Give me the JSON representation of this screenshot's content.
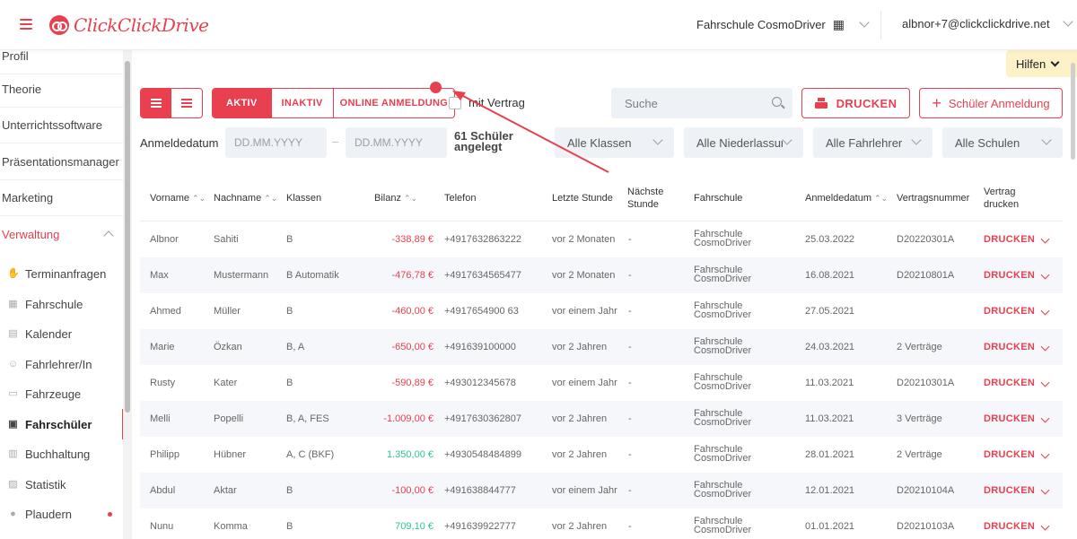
{
  "header": {
    "logo_text": "ClickClickDrive",
    "school": "Fahrschule CosmoDriver",
    "user": "albnor+7@clickclickdrive.net"
  },
  "sidebar": {
    "items": [
      {
        "label": "Profil"
      },
      {
        "label": "Theorie"
      },
      {
        "label": "Unterrichtssoftware"
      },
      {
        "label": "Präsentationsmanager"
      },
      {
        "label": "Marketing"
      },
      {
        "label": "Verwaltung"
      }
    ],
    "sub_items": [
      {
        "label": "Terminanfragen",
        "icon": "hand-icon"
      },
      {
        "label": "Fahrschule",
        "icon": "building-icon"
      },
      {
        "label": "Kalender",
        "icon": "calendar-icon"
      },
      {
        "label": "Fahrlehrer/In",
        "icon": "instructor-icon"
      },
      {
        "label": "Fahrzeuge",
        "icon": "car-icon"
      },
      {
        "label": "Fahrschüler",
        "icon": "student-card-icon"
      },
      {
        "label": "Buchhaltung",
        "icon": "ledger-icon"
      },
      {
        "label": "Statistik",
        "icon": "chart-icon"
      },
      {
        "label": "Plaudern",
        "icon": "chat-icon"
      }
    ]
  },
  "toolbar": {
    "hilfen": "Hilfen",
    "tab_active": "AKTIV",
    "tab_inactive": "INAKTIV",
    "tab_online": "ONLINE ANMELDUNG",
    "with_contract": "mit Vertrag",
    "search_placeholder": "Suche",
    "print": "DRUCKEN",
    "add_student": "Schüler Anmeldung"
  },
  "filters": {
    "date_label": "Anmeldedatum",
    "date_from_placeholder": "DD.MM.YYYY",
    "date_to_placeholder": "DD.MM.YYYY",
    "count": "61 Schüler angelegt",
    "classes": "Alle Klassen",
    "branches": "Alle Niederlassungen",
    "instructors": "Alle Fahrlehrer",
    "schools": "Alle Schulen"
  },
  "table": {
    "headers": {
      "first": "Vorname",
      "last": "Nachname",
      "classes": "Klassen",
      "balance": "Bilanz",
      "phone": "Telefon",
      "last_lesson": "Letzte Stunde",
      "next_lesson": "Nächste Stunde",
      "school": "Fahrschule",
      "reg_date": "Anmeldedatum",
      "contract_no": "Vertragsnummer",
      "contract_print": "Vertrag drucken"
    },
    "print_label": "DRUCKEN",
    "rows": [
      {
        "first": "Albnor",
        "last": "Sahiti",
        "classes": "B",
        "balance": "-338,89 €",
        "phone": "+4917632863222",
        "last_lesson": "vor 2 Monaten",
        "next": "-",
        "school": "Fahrschule CosmoDriver",
        "date": "25.03.2022",
        "contract": "D20220301A"
      },
      {
        "first": "Max",
        "last": "Mustermann",
        "classes": "B Automatik",
        "balance": "-476,78 €",
        "phone": "+4917634565477",
        "last_lesson": "vor 2 Monaten",
        "next": "-",
        "school": "Fahrschule CosmoDriver",
        "date": "16.08.2021",
        "contract": "D20210801A"
      },
      {
        "first": "Ahmed",
        "last": "Müller",
        "classes": "B",
        "balance": "-460,00 €",
        "phone": "+4917654900 63",
        "last_lesson": "vor einem Jahr",
        "next": "-",
        "school": "Fahrschule CosmoDriver",
        "date": "27.05.2021",
        "contract": ""
      },
      {
        "first": "Marie",
        "last": "Özkan",
        "classes": "B, A",
        "balance": "-650,00 €",
        "phone": "+491639100000",
        "last_lesson": "vor 2 Jahren",
        "next": "-",
        "school": "Fahrschule CosmoDriver",
        "date": "24.03.2021",
        "contract": "2 Verträge"
      },
      {
        "first": "Rusty",
        "last": "Kater",
        "classes": "B",
        "balance": "-590,89 €",
        "phone": "+493012345678",
        "last_lesson": "vor einem Jahr",
        "next": "-",
        "school": "Fahrschule CosmoDriver",
        "date": "11.03.2021",
        "contract": "D20210301A"
      },
      {
        "first": "Melli",
        "last": "Popelli",
        "classes": "B, A, FES",
        "balance": "-1.009,00 €",
        "phone": "+4917630362807",
        "last_lesson": "vor 2 Jahren",
        "next": "-",
        "school": "Fahrschule CosmoDriver",
        "date": "11.03.2021",
        "contract": "3 Verträge"
      },
      {
        "first": "Philipp",
        "last": "Hübner",
        "classes": "A, C (BKF)",
        "balance": "1.350,00 €",
        "phone": "+4930548484899",
        "last_lesson": "vor 2 Jahren",
        "next": "-",
        "school": "Fahrschule CosmoDriver",
        "date": "28.01.2021",
        "contract": "2 Verträge"
      },
      {
        "first": "Abdul",
        "last": "Aktar",
        "classes": "B",
        "balance": "-100,00 €",
        "phone": "+491638844777",
        "last_lesson": "vor einem Jahr",
        "next": "-",
        "school": "Fahrschule CosmoDriver",
        "date": "12.01.2021",
        "contract": "D20210104A"
      },
      {
        "first": "Nunu",
        "last": "Komma",
        "classes": "B",
        "balance": "709,10 €",
        "phone": "+491639922777",
        "last_lesson": "vor 2 Jahren",
        "next": "-",
        "school": "Fahrschule CosmoDriver",
        "date": "01.01.2021",
        "contract": "D20210103A"
      }
    ]
  },
  "colors": {
    "accent": "#e8404f",
    "positive": "#2fc392",
    "help_bg": "#fdf1c8"
  }
}
